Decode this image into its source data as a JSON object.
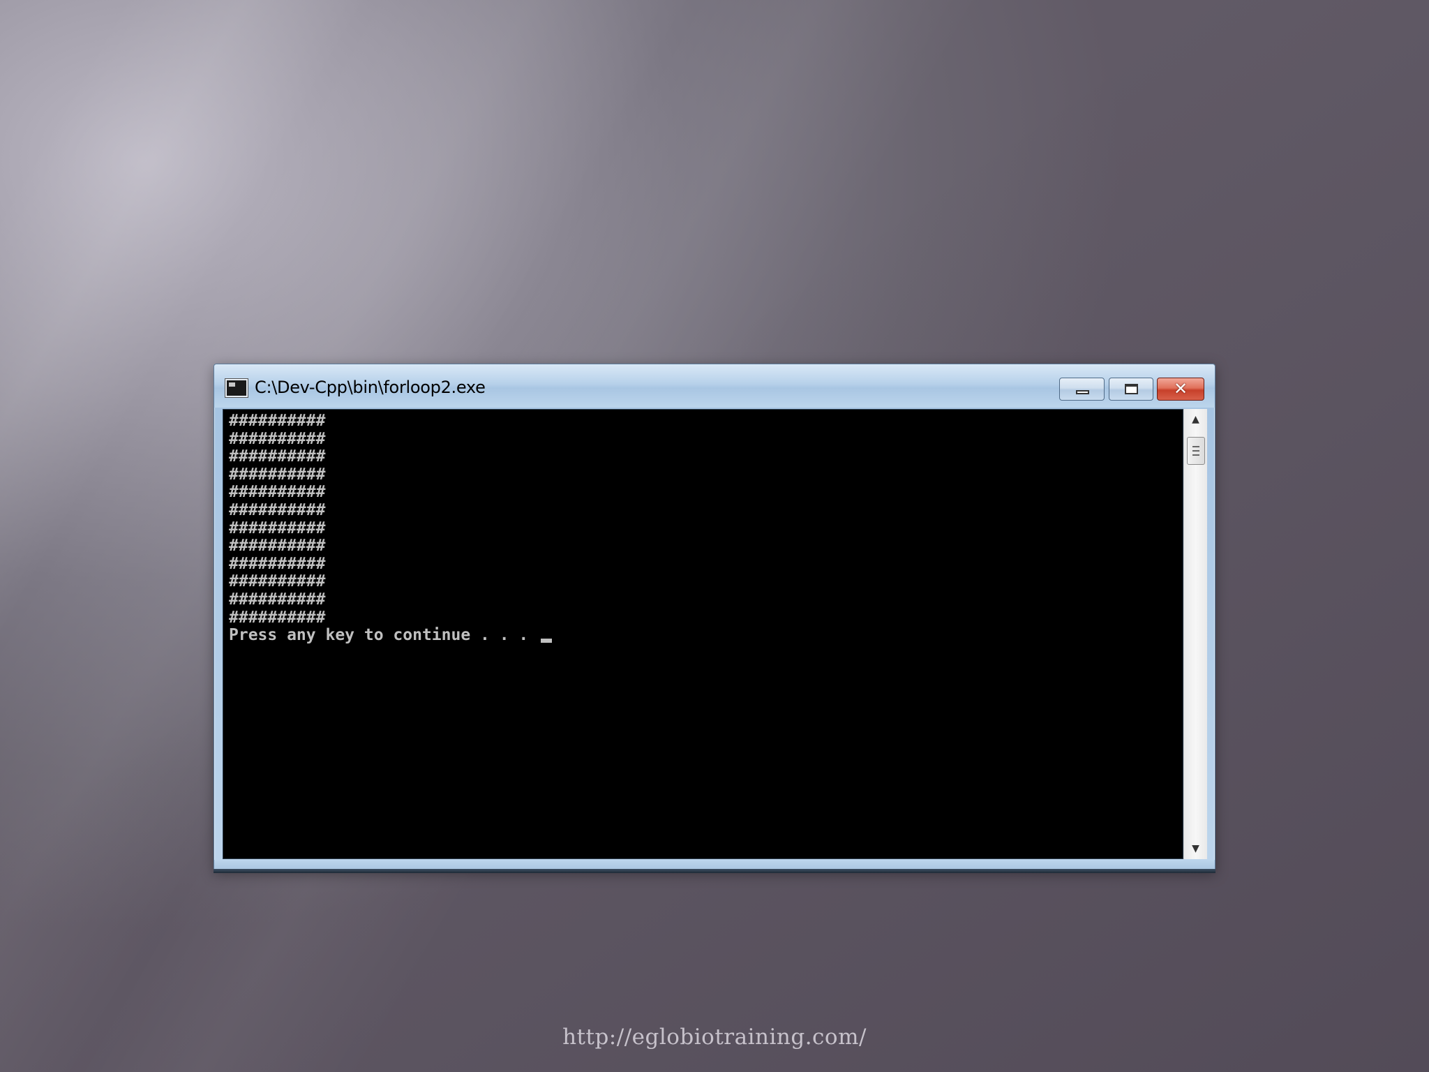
{
  "window": {
    "title": "C:\\Dev-Cpp\\bin\\forloop2.exe",
    "icon": "console-app-icon",
    "buttons": {
      "minimize": "minimize-icon",
      "maximize": "maximize-icon",
      "close_glyph": "✕"
    }
  },
  "console": {
    "hash_rows": [
      "##########",
      "##########",
      "##########",
      "##########",
      "##########",
      "##########",
      "##########",
      "##########",
      "##########",
      "##########",
      "##########",
      "##########"
    ],
    "prompt": "Press any key to continue . . . "
  },
  "scrollbar": {
    "up_glyph": "▲",
    "down_glyph": "▼"
  },
  "footer": {
    "url": "http://eglobiotraining.com/"
  },
  "colors": {
    "console_text": "#c0c0c0",
    "console_bg": "#000000",
    "titlebar": "#b7d1ea",
    "close_button": "#c7402a"
  }
}
